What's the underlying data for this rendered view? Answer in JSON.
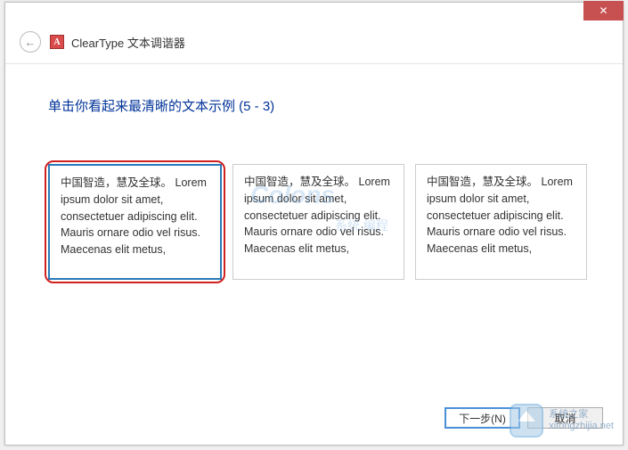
{
  "window": {
    "title": "ClearType 文本调谐器"
  },
  "content": {
    "instruction": "单击你看起来最清晰的文本示例 (5 - 3)",
    "samples": [
      {
        "text_cn": "中国智造，慧及全球。",
        "text_en": "Lorem ipsum dolor sit amet, consectetuer adipiscing elit. Mauris ornare odio vel risus. Maecenas elit metus,",
        "selected": true
      },
      {
        "text_cn": "中国智造，慧及全球。",
        "text_en": "Lorem ipsum dolor sit amet, consectetuer adipiscing elit. Mauris ornare odio vel risus. Maecenas elit metus,",
        "selected": false
      },
      {
        "text_cn": "中国智造，慧及全球。",
        "text_en": "Lorem ipsum dolor sit amet, consectetuer adipiscing elit. Mauris ornare odio vel risus. Maecenas elit metus,",
        "selected": false
      }
    ]
  },
  "footer": {
    "next_label": "下一步(N)",
    "cancel_label": "取消"
  },
  "watermark": {
    "main": "Colons",
    "sub": "系统 编程",
    "site_cn": "系统之家",
    "site_url": "xitongzhijia.net"
  }
}
